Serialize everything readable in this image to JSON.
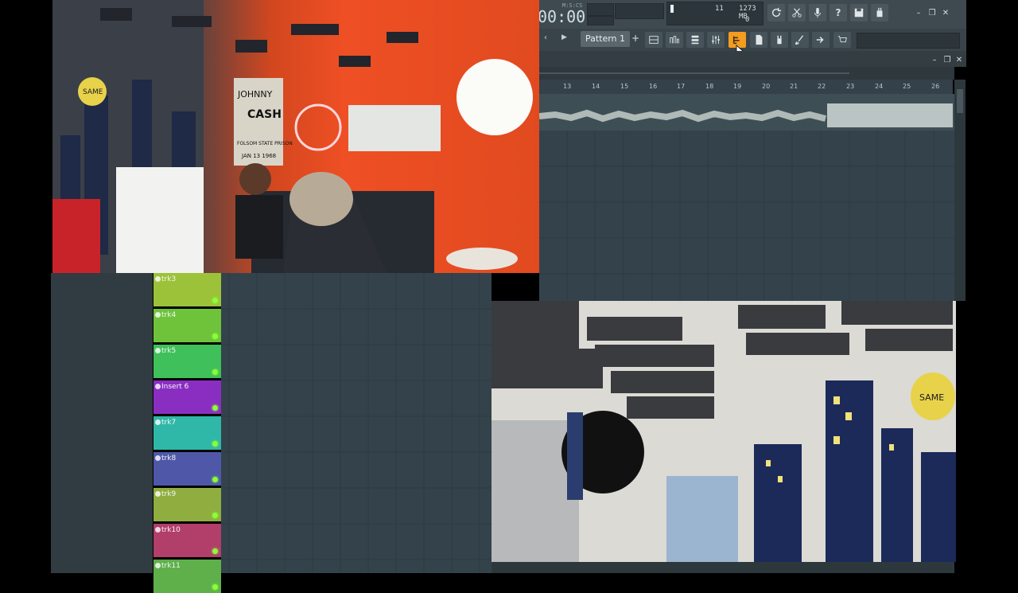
{
  "toolbar": {
    "time_big": "00:00",
    "time_unit": "M:S:CS",
    "cpu": "11",
    "memory": "1273 MB",
    "polyphony": "0",
    "icons": [
      "refresh-icon",
      "cut-icon",
      "mic-icon",
      "help-icon",
      "save-icon",
      "plugin-icon"
    ]
  },
  "toolbar2": {
    "pattern": "Pattern 1",
    "tools": [
      "playlist-icon",
      "piano-roll-icon",
      "channel-rack-icon",
      "mixer-icon",
      "step-sequencer-icon",
      "browser-icon",
      "plugin-picker-icon",
      "brush-icon",
      "render-icon",
      "cart-icon"
    ]
  },
  "ruler": {
    "marks": [
      "13",
      "14",
      "15",
      "16",
      "17",
      "18",
      "19",
      "20",
      "21",
      "22",
      "23",
      "24",
      "25",
      "26"
    ]
  },
  "tracks": [
    {
      "label": "trk3",
      "color": "#9cc23a"
    },
    {
      "label": "trk4",
      "color": "#6fc33b"
    },
    {
      "label": "trk5",
      "color": "#3fc05a"
    },
    {
      "label": "Insert 6",
      "color": "#8a2ec2"
    },
    {
      "label": "trk7",
      "color": "#2fb8a7"
    },
    {
      "label": "trk8",
      "color": "#4f58a8"
    },
    {
      "label": "trk9",
      "color": "#8fae3f"
    },
    {
      "label": "trk10",
      "color": "#b23e6a"
    },
    {
      "label": "trk11",
      "color": "#5fb04a"
    }
  ],
  "camera1": {
    "poster_line1": "JOHNNY",
    "poster_line2": "CASH",
    "poster_line3": "FOLSOM STATE PRISON",
    "poster_line4": "JAN 13 1968",
    "sign": "SAME"
  },
  "camera2": {
    "sign": "SAME"
  }
}
